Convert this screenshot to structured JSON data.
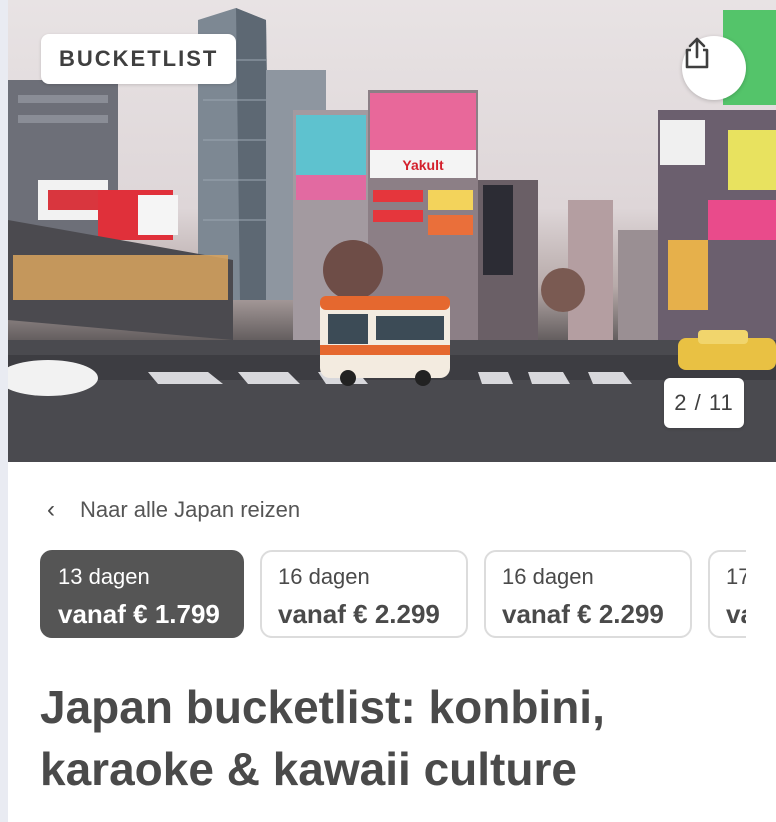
{
  "hero": {
    "badge": "BUCKETLIST",
    "counter": "2 / 11",
    "sign_text": "Yakult"
  },
  "back_link": {
    "label": "Naar alle Japan reizen"
  },
  "options": [
    {
      "days": "13 dagen",
      "price": "vanaf € 1.799",
      "selected": true
    },
    {
      "days": "16 dagen",
      "price": "vanaf € 2.299",
      "selected": false
    },
    {
      "days": "16 dagen",
      "price": "vanaf € 2.299",
      "selected": false
    },
    {
      "days": "17",
      "price": "va",
      "selected": false
    }
  ],
  "title": "Japan bucketlist: konbini, karaoke & kawaii culture",
  "icons": {
    "share": "share-icon",
    "back": "chevron-left-icon"
  },
  "colors": {
    "selected_bg": "#555555",
    "text": "#4a4a4a",
    "border": "#dcdcdc"
  }
}
